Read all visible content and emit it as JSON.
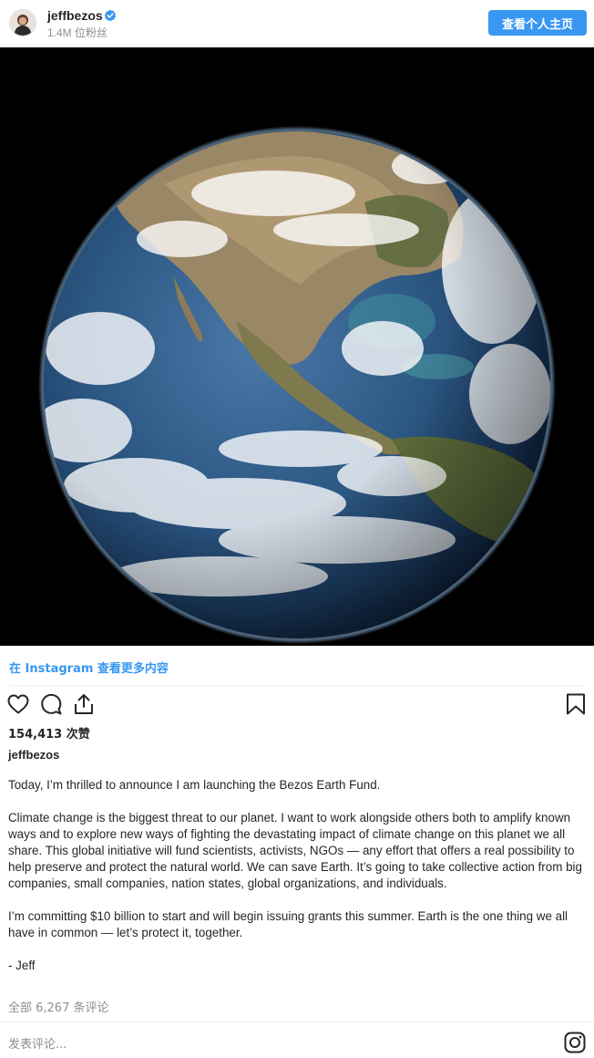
{
  "header": {
    "username": "jeffbezos",
    "followers": "1.4M 位粉丝",
    "profile_button": "查看个人主页"
  },
  "post": {
    "more_link": "在 Instagram 查看更多内容",
    "likes": "154,413 次赞",
    "caption_username": "jeffbezos",
    "caption_paragraphs": [
      "Today, I’m thrilled to announce I am launching the Bezos Earth Fund.",
      "Climate change is the biggest threat to our planet. I want to work alongside others both to amplify known ways and to explore new ways of fighting the devastating impact of climate change on this planet we all share. This global initiative will fund scientists, activists, NGOs — any effort that offers a real possibility to help preserve and protect the natural world. We can save Earth. It’s going to take collective action from big companies, small companies, nation states, global organizations, and individuals.",
      "I’m committing $10 billion to start and will begin issuing grants this summer. Earth is the one thing we all have in common — let’s protect it, together.",
      "- Jeff"
    ],
    "comments_count": "全部 6,267 条评论",
    "comment_placeholder": "发表评论..."
  },
  "icons": {
    "verified": "verified-badge-icon",
    "like": "heart-icon",
    "comment": "comment-icon",
    "share": "share-icon",
    "save": "bookmark-icon",
    "instagram": "instagram-icon"
  },
  "colors": {
    "accent": "#3897f0",
    "secondary_text": "#8e8e8e",
    "photo_background": "#000000"
  }
}
